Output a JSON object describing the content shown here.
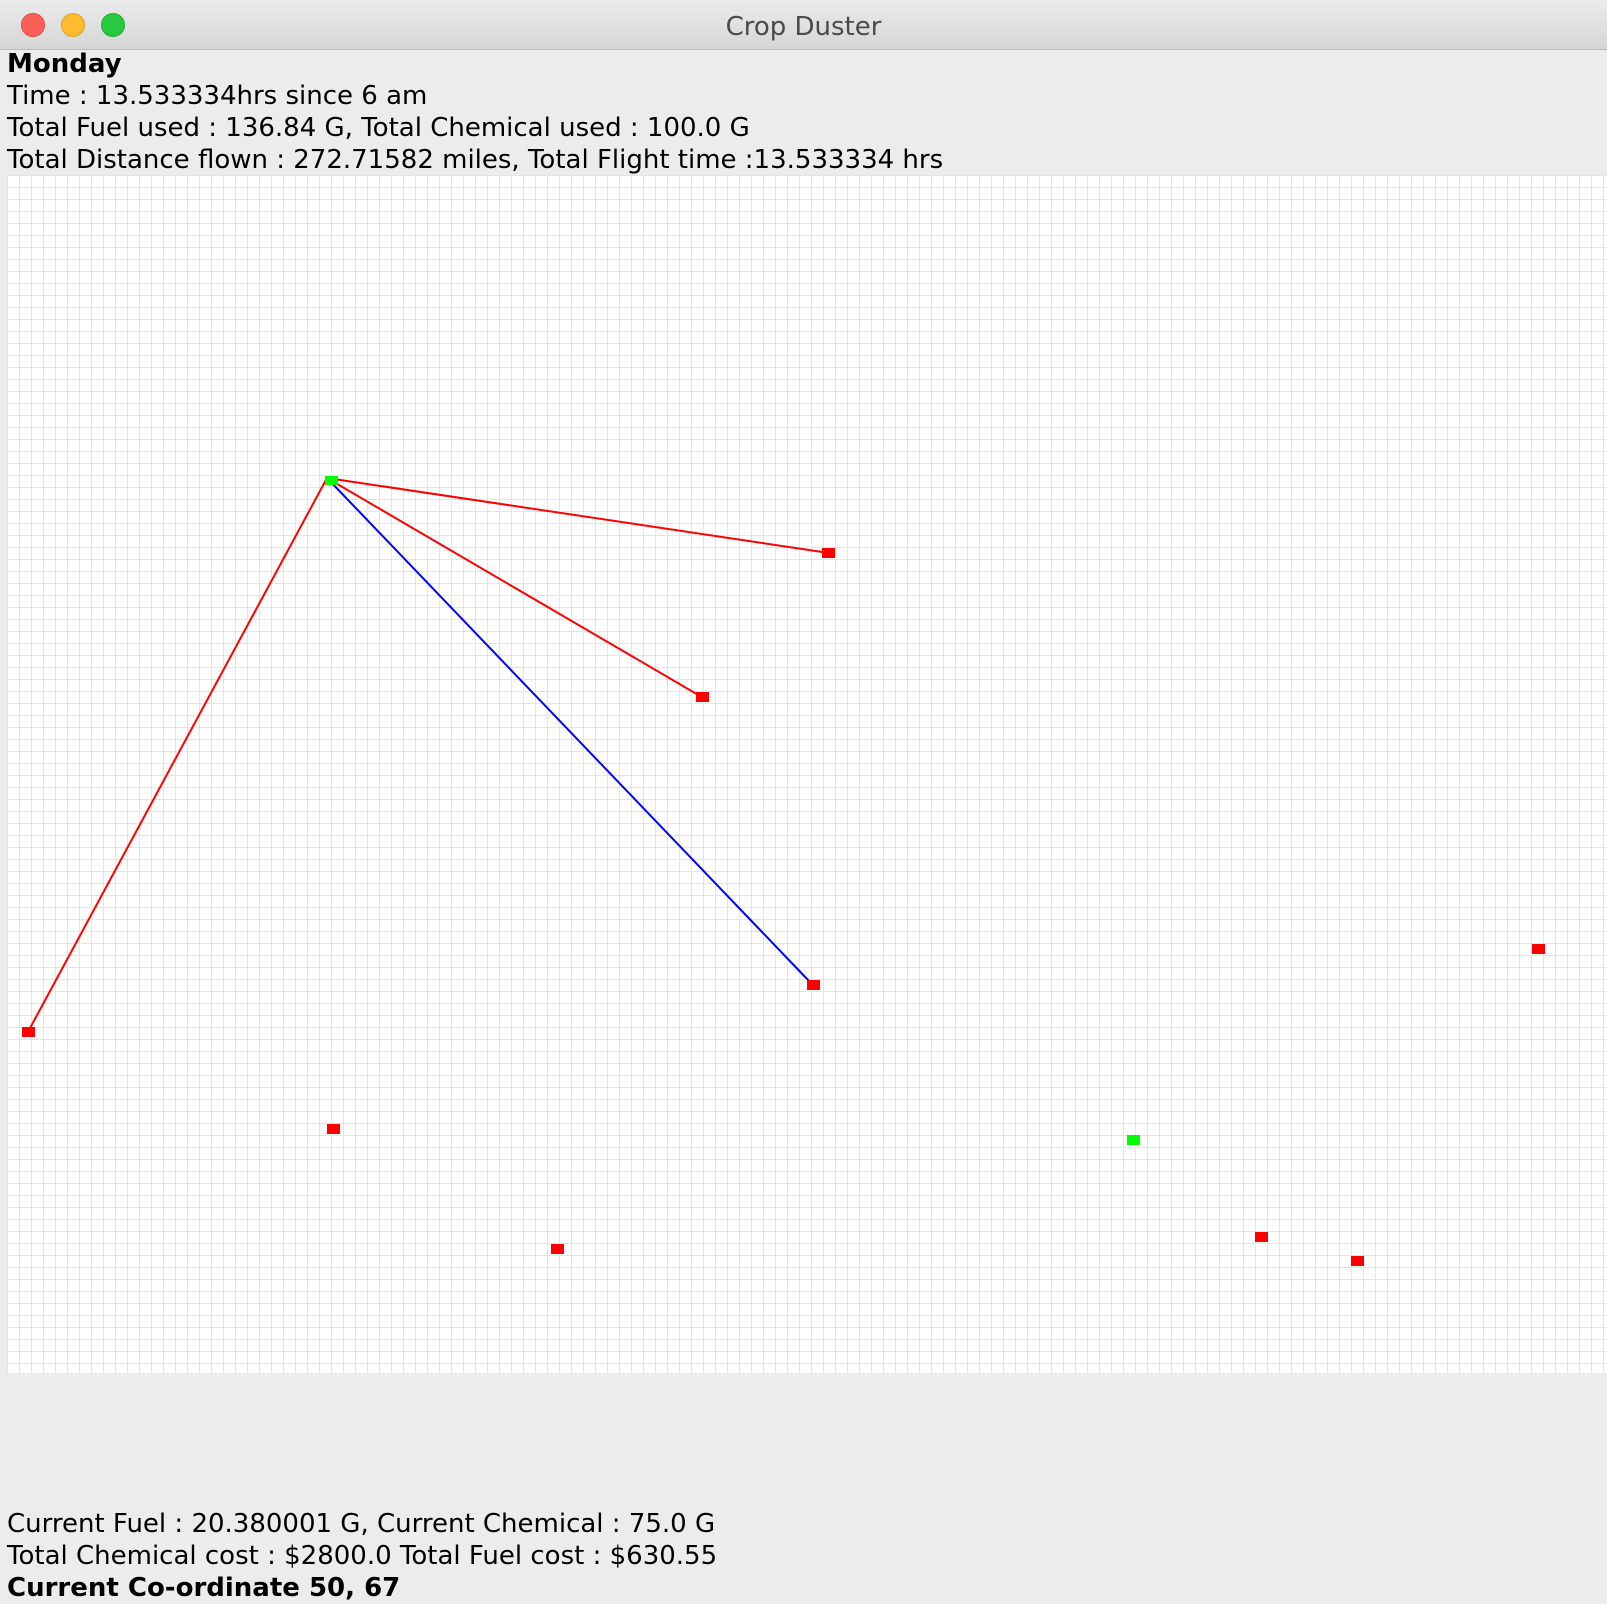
{
  "window": {
    "title": "Crop Duster"
  },
  "header": {
    "day": "Monday",
    "time": "Time : 13.533334hrs since 6 am",
    "totals_usage": "Total Fuel used : 136.84 G, Total Chemical used : 100.0 G",
    "totals_flight": "Total Distance flown : 272.71582 miles, Total Flight time :13.533334 hrs"
  },
  "footer": {
    "current_resources": "Current Fuel : 20.380001 G, Current Chemical : 75.0 G",
    "costs": "Total Chemical cost : $2800.0 Total Fuel cost : $630.55",
    "coordinate": "Current Co-ordinate 50, 67"
  },
  "colors": {
    "field": "#ff0000",
    "airport": "#00ff00",
    "sprayed_route": "#ff0000",
    "current_route": "#0000ff"
  }
}
